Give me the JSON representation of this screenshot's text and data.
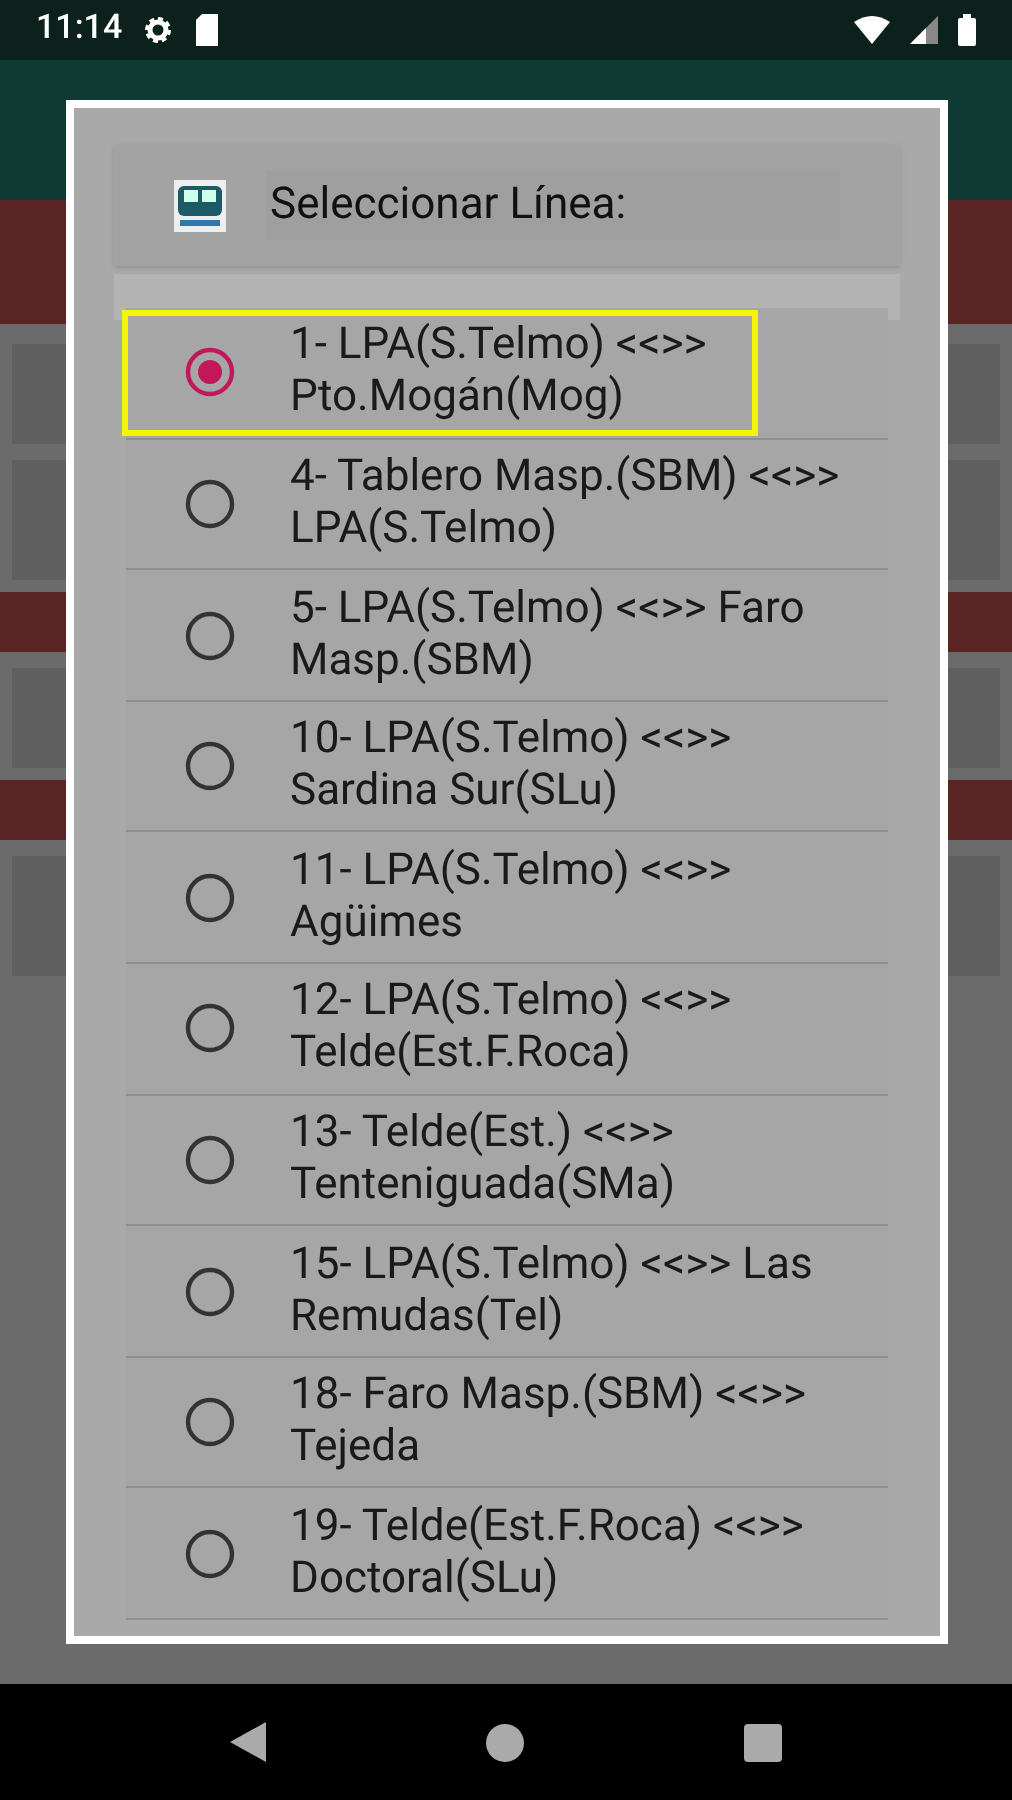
{
  "status_bar": {
    "time": "11:14"
  },
  "dialog": {
    "title": "Seleccionar Línea:",
    "options": [
      {
        "label": "1- LPA(S.Telmo) <<>> Pto.Mogán(Mog)",
        "selected": true,
        "highlighted": true
      },
      {
        "label": "4- Tablero Masp.(SBM) <<>> LPA(S.Telmo)",
        "selected": false,
        "highlighted": false
      },
      {
        "label": "5- LPA(S.Telmo) <<>> Faro Masp.(SBM)",
        "selected": false,
        "highlighted": false
      },
      {
        "label": "10- LPA(S.Telmo) <<>> Sardina Sur(SLu)",
        "selected": false,
        "highlighted": false
      },
      {
        "label": "11- LPA(S.Telmo) <<>> Agüimes",
        "selected": false,
        "highlighted": false
      },
      {
        "label": "12- LPA(S.Telmo) <<>> Telde(Est.F.Roca)",
        "selected": false,
        "highlighted": false
      },
      {
        "label": "13- Telde(Est.) <<>> Tenteniguada(SMa)",
        "selected": false,
        "highlighted": false
      },
      {
        "label": "15- LPA(S.Telmo) <<>> Las Remudas(Tel)",
        "selected": false,
        "highlighted": false
      },
      {
        "label": "18- Faro Masp.(SBM) <<>> Tejeda",
        "selected": false,
        "highlighted": false
      },
      {
        "label": "19- Telde(Est.F.Roca) <<>> Doctoral(SLu)",
        "selected": false,
        "highlighted": false
      }
    ]
  }
}
